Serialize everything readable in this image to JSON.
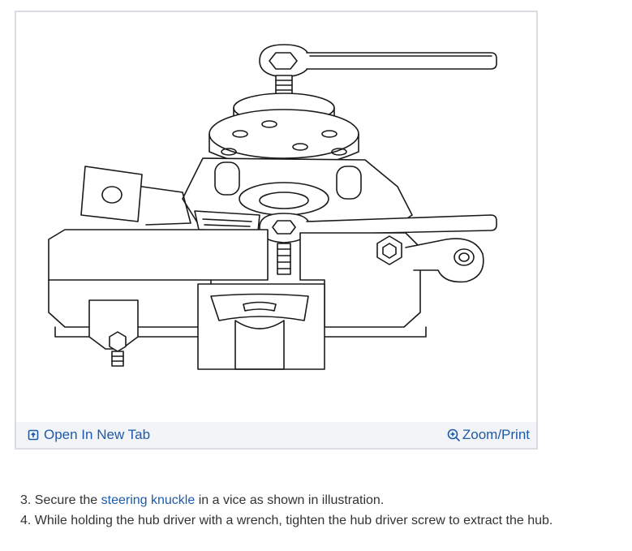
{
  "figure": {
    "open_tab_label": "Open In New Tab",
    "open_tab_icon": "open-new-tab-icon",
    "zoom_label": "Zoom/Print",
    "zoom_icon": "zoom-in-icon"
  },
  "steps": [
    {
      "number": "3.",
      "before": "Secure the",
      "link_text": "steering knuckle",
      "after": "in a vice as shown in illustration."
    },
    {
      "number": "4.",
      "text": "While holding the hub driver with a wrench, tighten the hub driver screw to extract the hub."
    }
  ],
  "colors": {
    "link": "#1e5aa8",
    "toolbar_bg": "#f2f4f7",
    "border": "#d9dde3",
    "text": "#333333"
  }
}
